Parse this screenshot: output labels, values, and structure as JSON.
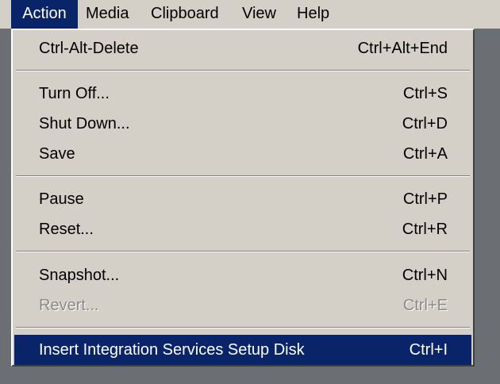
{
  "menubar": {
    "items": [
      {
        "label": "Action"
      },
      {
        "label": "Media"
      },
      {
        "label": "Clipboard"
      },
      {
        "label": "View"
      },
      {
        "label": "Help"
      }
    ]
  },
  "action_menu": {
    "items": [
      {
        "label": "Ctrl-Alt-Delete",
        "shortcut": "Ctrl+Alt+End",
        "enabled": true
      },
      {
        "label": "Turn Off...",
        "shortcut": "Ctrl+S",
        "enabled": true
      },
      {
        "label": "Shut Down...",
        "shortcut": "Ctrl+D",
        "enabled": true
      },
      {
        "label": "Save",
        "shortcut": "Ctrl+A",
        "enabled": true
      },
      {
        "label": "Pause",
        "shortcut": "Ctrl+P",
        "enabled": true
      },
      {
        "label": "Reset...",
        "shortcut": "Ctrl+R",
        "enabled": true
      },
      {
        "label": "Snapshot...",
        "shortcut": "Ctrl+N",
        "enabled": true
      },
      {
        "label": "Revert...",
        "shortcut": "Ctrl+E",
        "enabled": false
      },
      {
        "label": "Insert Integration Services Setup Disk",
        "shortcut": "Ctrl+I",
        "enabled": true,
        "highlighted": true
      }
    ]
  },
  "colors": {
    "highlight": "#0a246a",
    "menu_background": "#d4d0c8",
    "desktop_background": "#6b6f73",
    "disabled_text": "#8c8a85"
  }
}
